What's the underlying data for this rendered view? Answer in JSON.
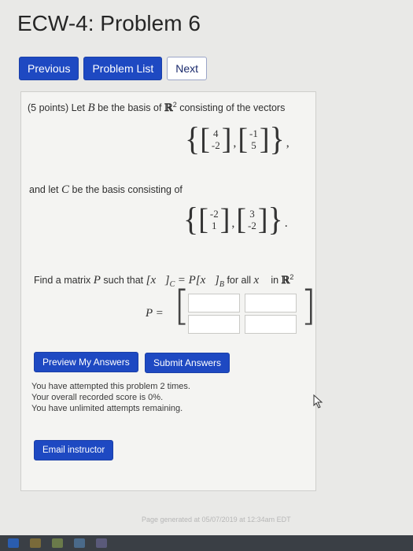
{
  "title": "ECW-4: Problem 6",
  "nav": {
    "previous": "Previous",
    "problem_list": "Problem List",
    "next": "Next"
  },
  "problem": {
    "intro_points": "(5 points) Let",
    "intro_basis": "be the basis of",
    "intro_end": "consisting of the vectors",
    "var_b": "B",
    "var_c": "C",
    "r2": "ℝ",
    "exp2": "2",
    "basis_b": [
      [
        "4",
        "-2"
      ],
      [
        "-1",
        "5"
      ]
    ],
    "basis_c_intro": "and let",
    "basis_c_mid": "be the basis consisting of",
    "basis_c": [
      [
        "-2",
        "1"
      ],
      [
        "3",
        "-2"
      ]
    ],
    "find_text": "Find a matrix",
    "find_var": "P",
    "find_such": "such that",
    "find_eq": "= P",
    "find_for_all": "for all",
    "find_in": "in",
    "x_vec": "x⃗",
    "answer_label": "P ="
  },
  "buttons": {
    "preview": "Preview My Answers",
    "submit": "Submit Answers",
    "email": "Email instructor"
  },
  "feedback": [
    "You have attempted this problem 2 times.",
    "Your overall recorded score is 0%.",
    "You have unlimited attempts remaining."
  ],
  "footer": "Page generated at 05/07/2019 at 12:34am EDT",
  "colors": {
    "primary_button": "#1e49c2",
    "panel_bg": "#f4f4f2"
  }
}
